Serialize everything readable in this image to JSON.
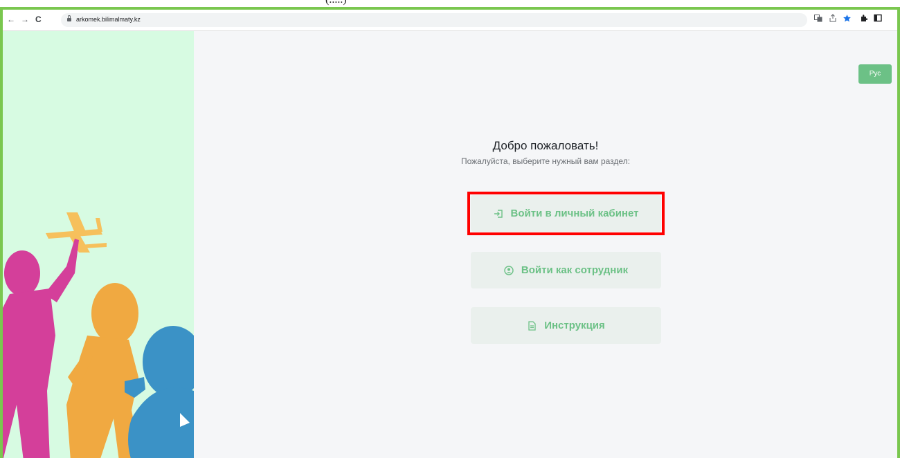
{
  "doc_fragment": {
    "text": "(.....)"
  },
  "browser": {
    "back_symbol": "←",
    "forward_symbol": "→",
    "reload_symbol": "C",
    "url": "arkomek.bilimalmaty.kz",
    "toolbar_icons": [
      "translate-icon",
      "share-icon",
      "bookmark-star-icon",
      "extensions-icon",
      "sidepanel-icon"
    ]
  },
  "page": {
    "language_button": "Рус",
    "title": "Добро пожаловать!",
    "subtitle": "Пожалуйста, выберите нужный вам раздел:",
    "buttons": [
      {
        "label": "Войти в личный кабинет",
        "icon": "login-icon"
      },
      {
        "label": "Войти как сотрудник",
        "icon": "user-circle-icon"
      },
      {
        "label": "Инструкция",
        "icon": "document-icon"
      }
    ]
  },
  "colors": {
    "accent_green": "#6cc186",
    "left_panel_bg": "#d7fbe2",
    "page_bg": "#f5f6f8",
    "highlight_red": "#ff0000",
    "frame_green": "#7ac74f"
  },
  "illustration": {
    "name": "children-playing-silhouettes"
  }
}
